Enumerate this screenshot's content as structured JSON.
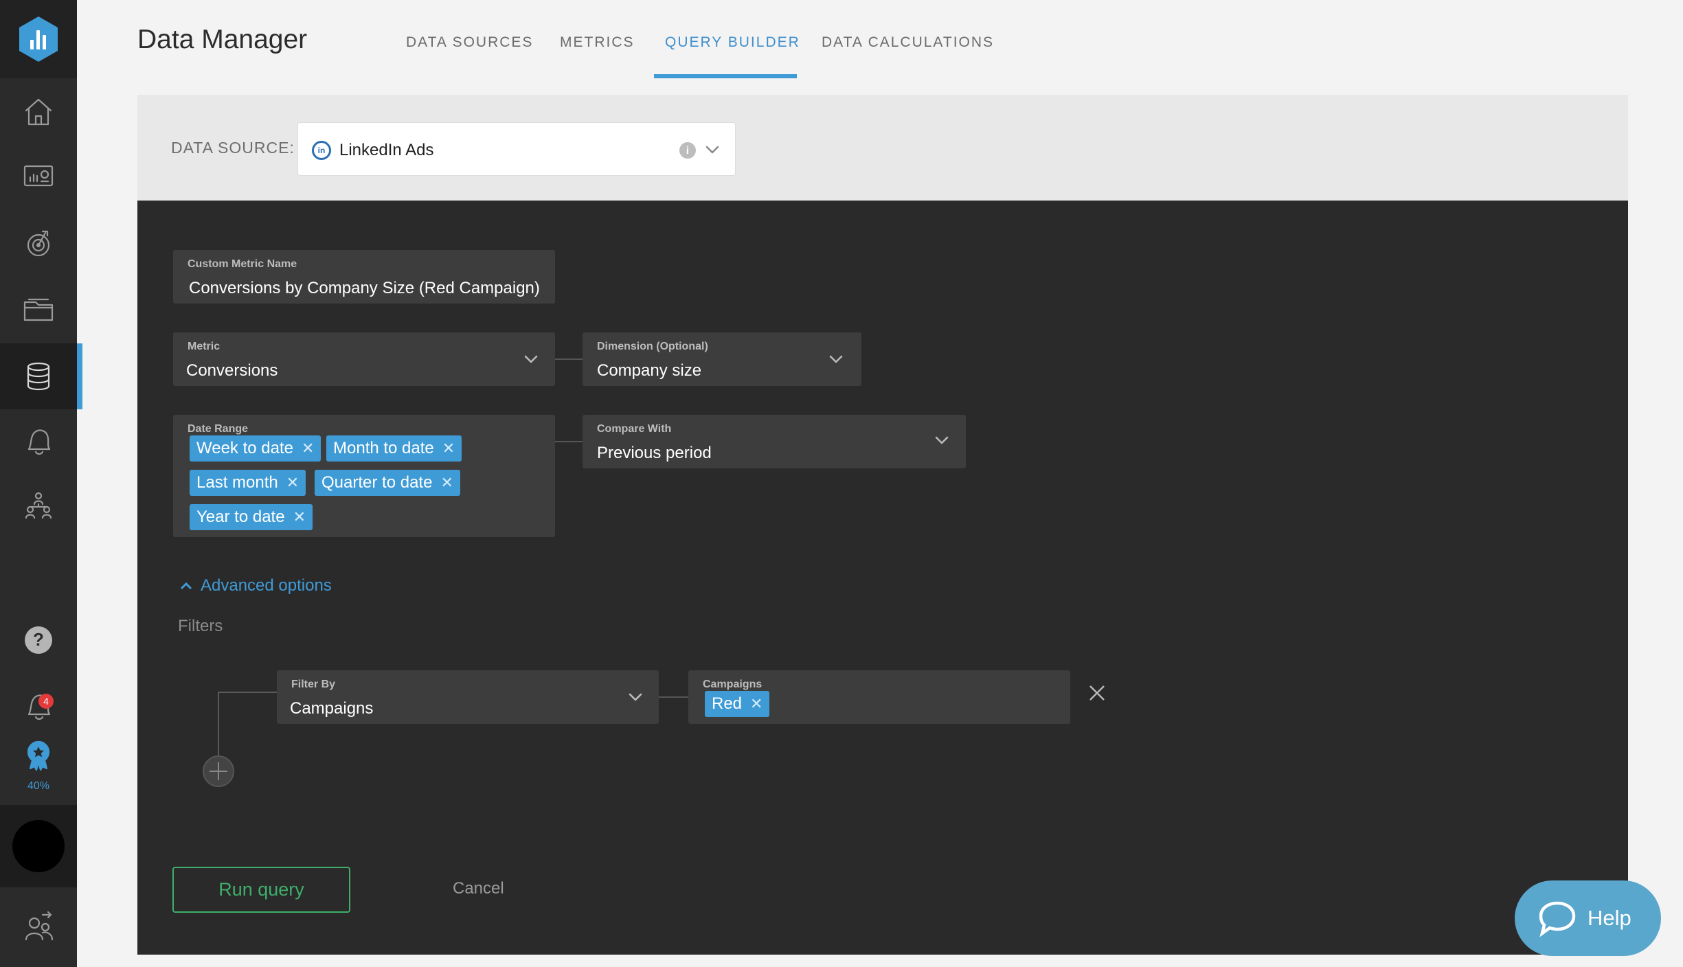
{
  "app": {
    "title": "Data Manager"
  },
  "tabs": [
    {
      "label": "DATA SOURCES",
      "active": false
    },
    {
      "label": "METRICS",
      "active": false
    },
    {
      "label": "QUERY BUILDER",
      "active": true
    },
    {
      "label": "DATA CALCULATIONS",
      "active": false
    }
  ],
  "sidebar": {
    "items": [
      {
        "icon": "home-icon"
      },
      {
        "icon": "dashboard-icon"
      },
      {
        "icon": "goals-icon"
      },
      {
        "icon": "folder-icon"
      },
      {
        "icon": "database-icon",
        "active": true
      },
      {
        "icon": "bell-icon"
      },
      {
        "icon": "team-icon"
      }
    ],
    "bottom": {
      "help_icon": "question-icon",
      "notifications_icon": "alert-icon",
      "notifications_count": "4",
      "progress_icon": "badge-icon",
      "progress_label": "40%",
      "user_icon": "user-switch-icon"
    }
  },
  "source": {
    "label": "DATA SOURCE:",
    "value": "LinkedIn Ads",
    "icon_text": "in"
  },
  "form": {
    "custom_metric_name": {
      "label": "Custom Metric Name",
      "value": "Conversions by Company Size (Red Campaign)"
    },
    "metric": {
      "label": "Metric",
      "value": "Conversions"
    },
    "dimension": {
      "label": "Dimension (Optional)",
      "value": "Company size"
    },
    "date_range": {
      "label": "Date Range",
      "chips": [
        "Week to date",
        "Month to date",
        "Last month",
        "Quarter to date",
        "Year to date"
      ]
    },
    "compare_with": {
      "label": "Compare With",
      "value": "Previous period"
    },
    "advanced_options": "Advanced options",
    "filters_label": "Filters",
    "filter_by": {
      "label": "Filter By",
      "value": "Campaigns"
    },
    "campaigns": {
      "label": "Campaigns",
      "chips": [
        "Red"
      ]
    }
  },
  "actions": {
    "run": "Run query",
    "cancel": "Cancel"
  },
  "help": {
    "label": "Help"
  },
  "colors": {
    "accent": "#3f9bd6",
    "run": "#3fae6a",
    "panel": "#2a2a2a",
    "field": "#3d3d3d"
  }
}
